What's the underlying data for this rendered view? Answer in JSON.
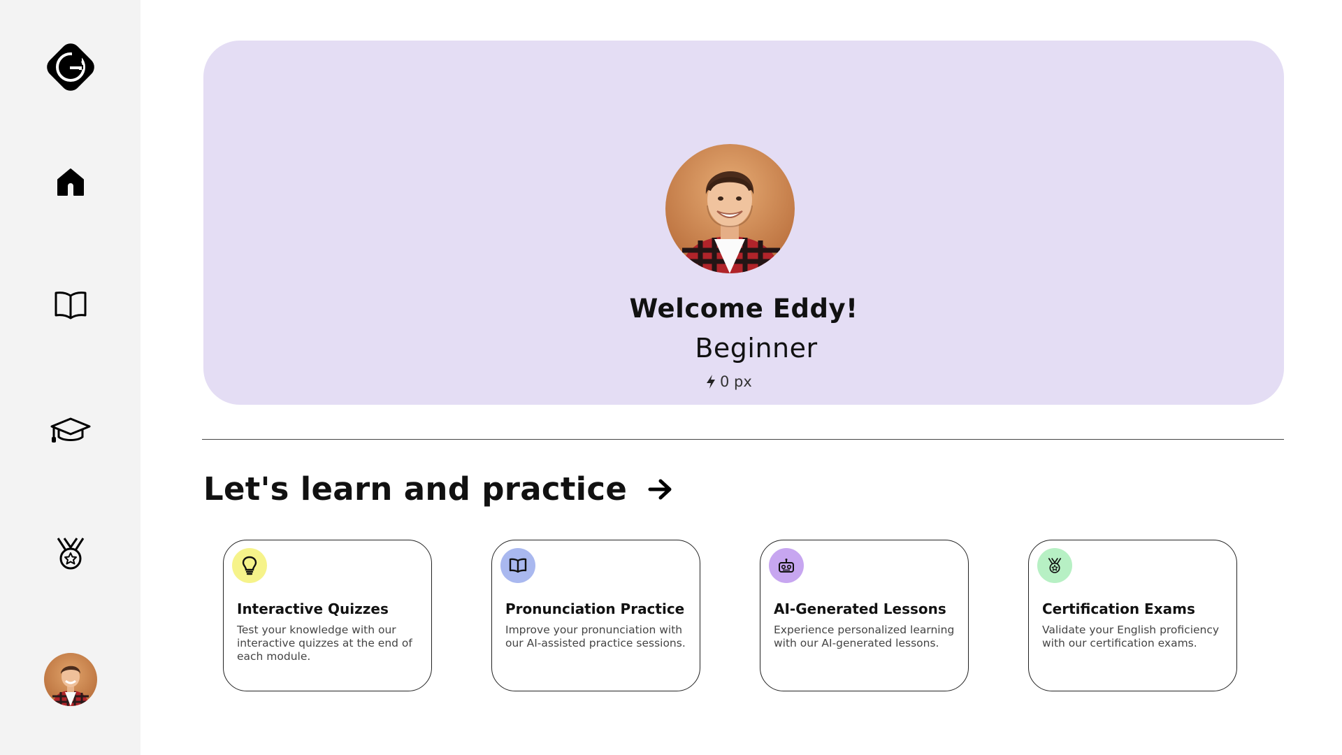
{
  "sidebar": {
    "logo_icon": "g-logo-icon",
    "items": [
      {
        "icon": "home-icon"
      },
      {
        "icon": "book-icon"
      },
      {
        "icon": "graduation-cap-icon"
      },
      {
        "icon": "medal-icon"
      },
      {
        "icon": "avatar"
      }
    ]
  },
  "hero": {
    "welcome": "Welcome Eddy!",
    "level": "Beginner",
    "xp": "0 px",
    "background": "#e4ddf4"
  },
  "section": {
    "title": "Let's learn and practice"
  },
  "cards": [
    {
      "title": "Interactive Quizzes",
      "desc": "Test your knowledge with our interactive quizzes at the end of each module.",
      "icon": "lightbulb-icon",
      "color": "#f6f38a"
    },
    {
      "title": "Pronunciation Practice",
      "desc": "Improve your pronunciation with our AI-assisted practice sessions.",
      "icon": "book-icon",
      "color": "#a9b8ef"
    },
    {
      "title": "AI-Generated Lessons",
      "desc": "Experience personalized learning with our AI-generated lessons.",
      "icon": "robot-icon",
      "color": "#c7a6f0"
    },
    {
      "title": "Certification Exams",
      "desc": "Validate your English proficiency with our certification exams.",
      "icon": "medal-icon",
      "color": "#b7f0c4"
    }
  ]
}
